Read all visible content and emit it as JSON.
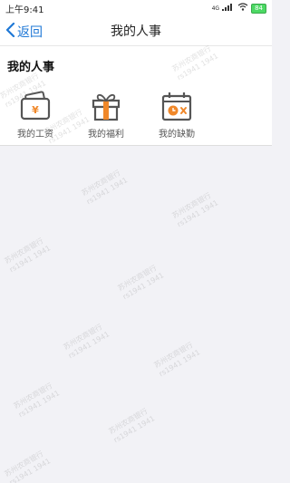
{
  "status": {
    "time": "上午9:41",
    "network": "4G",
    "battery": "84"
  },
  "nav": {
    "back_label": "返回",
    "title": "我的人事"
  },
  "section": {
    "title": "我的人事"
  },
  "items": [
    {
      "label": "我的工资",
      "icon": "wallet-yen-icon"
    },
    {
      "label": "我的福利",
      "icon": "gift-icon"
    },
    {
      "label": "我的缺勤",
      "icon": "calendar-clock-icon"
    }
  ],
  "watermark": {
    "line1": "苏州农商银行",
    "line2": "rs1941 1941"
  },
  "colors": {
    "accent": "#1f78d6",
    "icon_orange": "#f0882a",
    "icon_dark": "#555555"
  }
}
